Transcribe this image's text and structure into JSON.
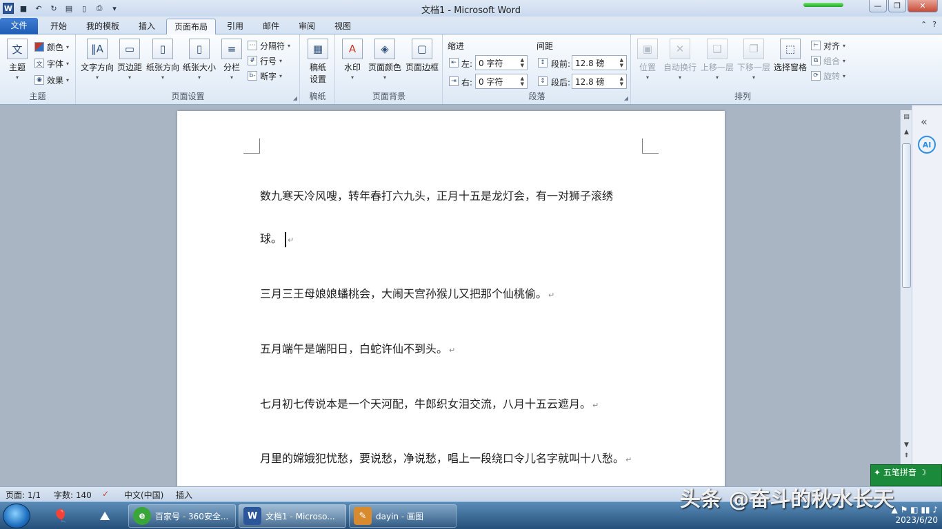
{
  "window": {
    "title": "文档1 - Microsoft Word"
  },
  "tabs": [
    "文件",
    "开始",
    "我的模板",
    "插入",
    "页面布局",
    "引用",
    "邮件",
    "审阅",
    "视图"
  ],
  "active_tab": "页面布局",
  "ribbon": {
    "theme_group": {
      "label": "主题",
      "theme_btn": "主题",
      "colors": "颜色",
      "fonts": "字体",
      "effects": "效果"
    },
    "page_setup": {
      "label": "页面设置",
      "text_direction": "文字方向",
      "margins": "页边距",
      "orientation": "纸张方向",
      "size": "纸张大小",
      "columns": "分栏",
      "breaks": "分隔符",
      "line_numbers": "行号",
      "hyphenation": "断字"
    },
    "manuscript": {
      "label": "稿纸",
      "btn": "稿纸\n设置",
      "btn1": "稿纸",
      "btn2": "设置"
    },
    "background": {
      "label": "页面背景",
      "watermark": "水印",
      "page_color": "页面颜色",
      "page_borders": "页面边框"
    },
    "paragraph": {
      "label": "段落",
      "indent": "缩进",
      "spacing": "间距",
      "left": "左:",
      "right": "右:",
      "before": "段前:",
      "after": "段后:",
      "left_val": "0 字符",
      "right_val": "0 字符",
      "before_val": "12.8 磅",
      "after_val": "12.8 磅"
    },
    "arrange": {
      "label": "排列",
      "position": "位置",
      "wrap": "自动换行",
      "forward": "上移一层",
      "backward": "下移一层",
      "selection_pane": "选择窗格",
      "align": "对齐",
      "group": "组合",
      "rotate": "旋转"
    }
  },
  "document": {
    "paragraphs": [
      "数九寒天冷风嗖，转年春打六九头，正月十五是龙灯会，有一对狮子滚绣",
      "球。",
      "三月三王母娘娘蟠桃会，大闹天宫孙猴儿又把那个仙桃偷。",
      "五月端午是端阳日，白蛇许仙不到头。",
      "七月初七传说本是一个天河配，牛郎织女泪交流，八月十五云遮月。",
      "月里的嫦娥犯忧愁，要说愁，净说愁，唱上一段绕口令儿名字就叫十八愁。"
    ],
    "para_mark": "↵"
  },
  "status": {
    "page": "页面: 1/1",
    "words": "字数: 140",
    "lang": "中文(中国)",
    "mode": "插入"
  },
  "ime": {
    "name": "五笔拼音"
  },
  "taskbar": {
    "tasks": [
      {
        "label": "百家号 - 360安全..."
      },
      {
        "label": "文档1 - Microso..."
      },
      {
        "label": "dayin - 画图"
      }
    ],
    "date": "2023/6/20"
  },
  "watermark_text": "头条 @奋斗的秋水长天",
  "colors": {
    "file_tab": "#2b6cc4",
    "accent": "#2b579a",
    "ime_bg": "#1b8a3a"
  }
}
